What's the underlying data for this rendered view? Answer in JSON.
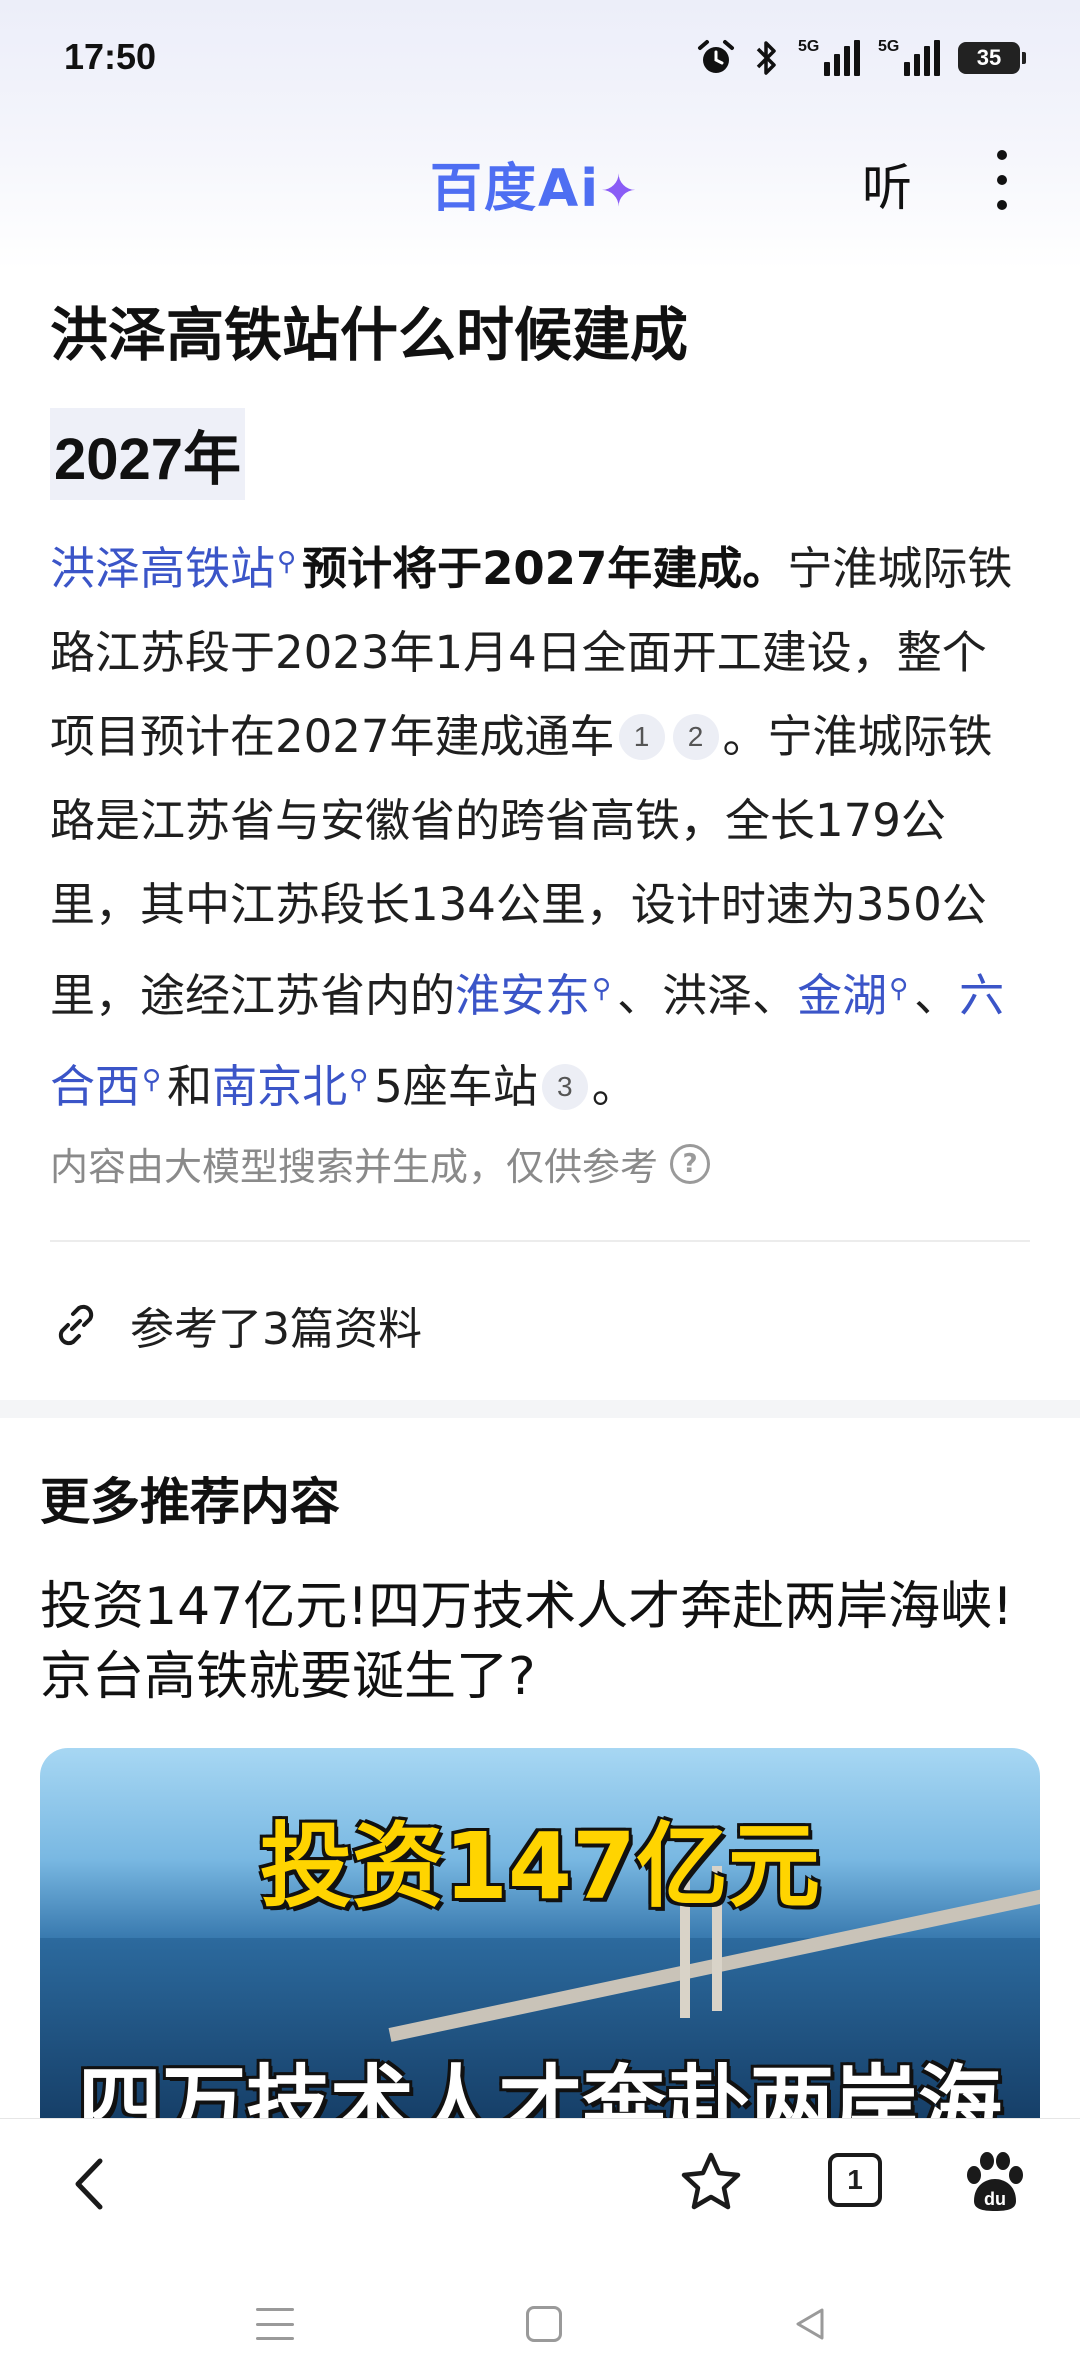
{
  "status_bar": {
    "time": "17:50",
    "signal1_label": "5G",
    "signal2_label": "5G",
    "battery_level": "35",
    "icons": [
      "alarm-icon",
      "bluetooth-icon",
      "signal-icon",
      "signal-icon",
      "battery-icon"
    ]
  },
  "header": {
    "logo_text": "百度Ai",
    "logo_spark": "✦",
    "listen_label": "听",
    "more_icon": "more-vertical-icon"
  },
  "answer": {
    "question": "洪泽高铁站什么时候建成",
    "short_answer": "2027年",
    "p1_link": "洪泽高铁站",
    "p1_bold": "预计将于2027年建成。",
    "p1_text": "宁淮城际铁路江苏段于2023年1月4日全面开工建设，整个项目预计在2027年建成通车",
    "cite1": "1",
    "cite2": "2",
    "p2_text": "。宁淮城际铁路是江苏省与安徽省的跨省高铁，全长179公里，其中江苏段长134公里，设计时速为350公里，途经江苏省内的",
    "link_huaiandong": "淮安东",
    "sep1": "、洪泽、",
    "link_jinhu": "金湖",
    "sep2": "、",
    "link_liuhexi": "六合西",
    "sep3": "和",
    "link_nanjingbei": "南京北",
    "p3_text": "5座车站",
    "cite3": "3",
    "p3_end": "。",
    "search_mark": "⚲",
    "disclaimer": "内容由大模型搜索并生成，仅供参考",
    "help_glyph": "?",
    "refs_label": "参考了3篇资料"
  },
  "recommend": {
    "section_title": "更多推荐内容",
    "article_title": "投资147亿元!四万技术人才奔赴两岸海峡!京台高铁就要诞生了?",
    "image_caption_top": "投资147亿元",
    "image_caption_bottom": "四万技术人才奔赴两岸海峡"
  },
  "toolbar": {
    "tab_count": "1",
    "icons": [
      "back-icon",
      "star-icon",
      "tabs-icon",
      "baidu-paw-icon"
    ]
  },
  "colors": {
    "link": "#3b55c8",
    "logo": "#4e6ef2",
    "spark": "#8a5cf6",
    "caption_yellow": "#ffd400"
  }
}
